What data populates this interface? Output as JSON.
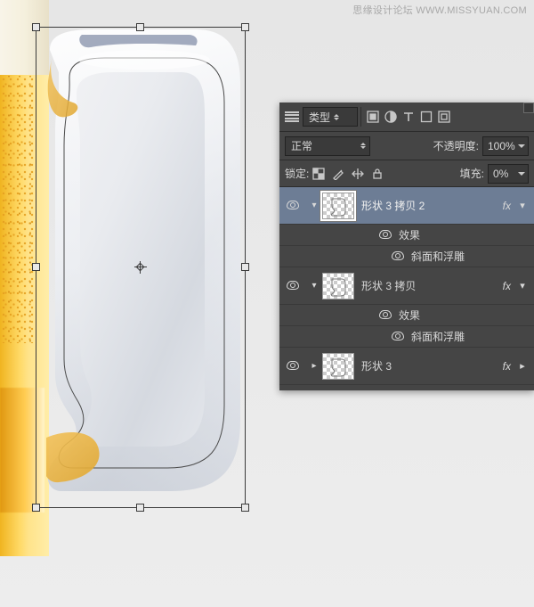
{
  "watermark": "思缘设计论坛   WWW.MISSYUAN.COM",
  "panel": {
    "filter_label": "类型",
    "blend_mode": "正常",
    "opacity_label": "不透明度:",
    "opacity_value": "100%",
    "lock_label": "锁定:",
    "fill_label": "填充:",
    "fill_value": "0%",
    "fx_badge": "fx",
    "effects_label": "效果",
    "bevel_label": "斜面和浮雕",
    "collapse_glyph": "▾",
    "expand_glyph": "▸",
    "layers": [
      {
        "name": "形状 3 拷贝 2",
        "selected": true,
        "expanded": true
      },
      {
        "name": "形状 3 拷贝",
        "selected": false,
        "expanded": true
      },
      {
        "name": "形状 3",
        "selected": false,
        "expanded": false
      }
    ]
  }
}
